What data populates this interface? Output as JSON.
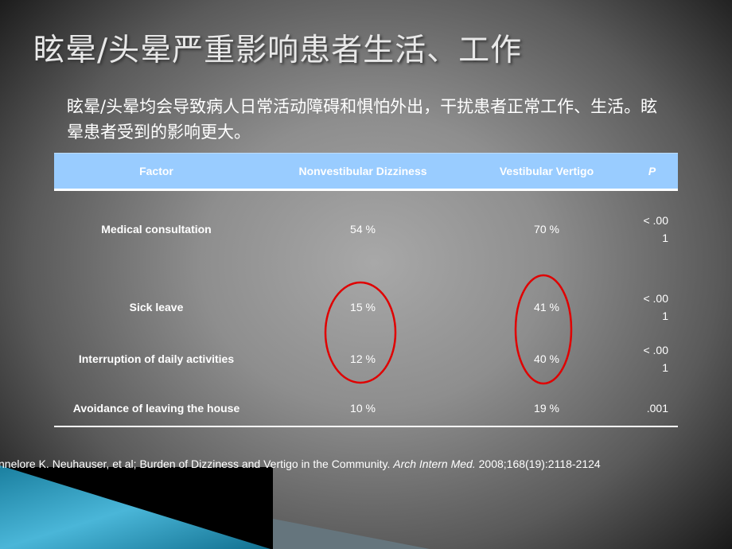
{
  "title": "眩晕/头晕严重影响患者生活、工作",
  "subtitle": "眩晕/头晕均会导致病人日常活动障碍和惧怕外出，干扰患者正常工作、生活。眩晕患者受到的影响更大。",
  "table": {
    "headers": [
      "Factor",
      "Nonvestibular Dizziness",
      "Vestibular Vertigo",
      "P"
    ],
    "rows": [
      {
        "factor": "Medical consultation",
        "nonvestibular": "54 %",
        "vestibular": "70 %",
        "p1": "< .00",
        "p2": "1"
      },
      {
        "factor": "Sick leave",
        "nonvestibular": "15 %",
        "vestibular": "41 %",
        "p1": "< .00",
        "p2": "1"
      },
      {
        "factor": "Interruption of daily activities",
        "nonvestibular": "12 %",
        "vestibular": "40 %",
        "p1": "< .00",
        "p2": "1"
      },
      {
        "factor": "Avoidance of leaving the house",
        "nonvestibular": "10 %",
        "vestibular": "19 %",
        "p1": ".001",
        "p2": ""
      }
    ]
  },
  "citation": {
    "text": "nnelore K. Neuhauser, et al; Burden of Dizziness and Vertigo in the Community. ",
    "journal": "Arch Intern Med.",
    "ref": " 2008;168(19):2118-2124"
  },
  "colors": {
    "header": "#99ccff",
    "highlight": "#e00000",
    "accent": "#2aa0c8"
  }
}
